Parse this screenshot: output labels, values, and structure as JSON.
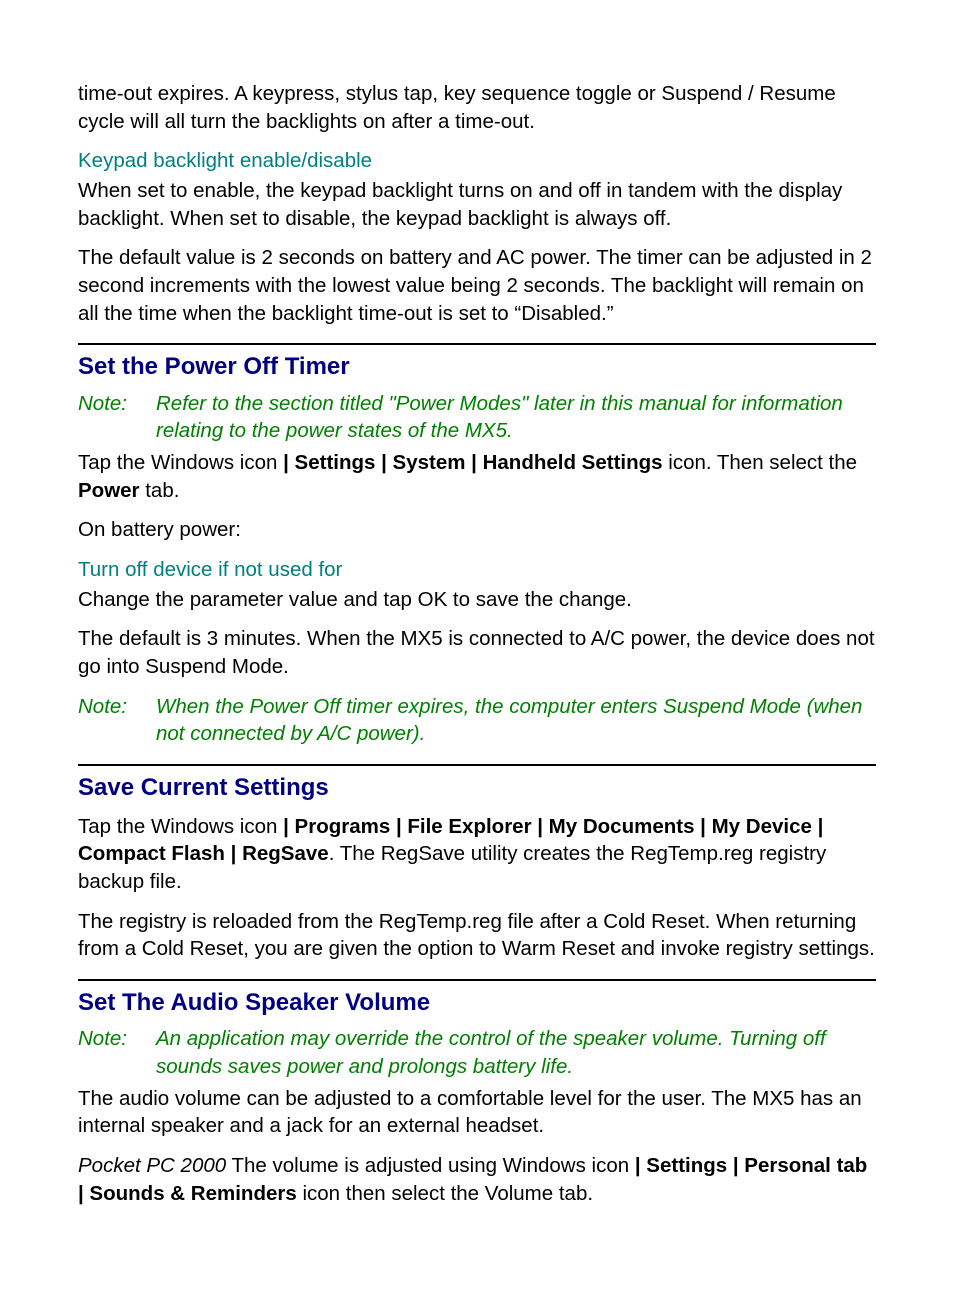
{
  "intro": {
    "p1": "time-out expires. A keypress, stylus tap, key sequence toggle or Suspend / Resume cycle will all turn the backlights on after a time-out.",
    "sub": "Keypad backlight enable/disable",
    "p2": "When set to enable, the keypad backlight turns on and off in tandem with the display backlight. When set to disable, the keypad backlight is always off.",
    "p3": "The default value is 2 seconds on battery and AC power. The timer can be adjusted in 2 second increments with the lowest value being 2 seconds. The backlight will remain on all the time when the backlight time-out is set to “Disabled.”"
  },
  "power": {
    "heading": "Set the Power Off Timer",
    "note1_label": "Note:",
    "note1_body": "Refer to the section titled \"Power Modes\" later in this manual for information relating to the power states of the MX5.",
    "tap1_a": "Tap the Windows icon ",
    "tap1_b": "| Settings | System | Handheld Settings",
    "tap1_c": " icon. Then select the ",
    "tap1_d": "Power",
    "tap1_e": " tab.",
    "onbatt": "On battery power:",
    "sub": "Turn off device if not used for",
    "p_change": "Change the parameter value and tap OK to save the change.",
    "p_default": "The default is 3 minutes. When the MX5 is connected to A/C power, the device does not go into Suspend Mode.",
    "note2_label": "Note:",
    "note2_body": "When the Power Off timer expires, the computer enters Suspend Mode (when not connected by A/C power)."
  },
  "save": {
    "heading": "Save Current Settings",
    "p1_a": "Tap the Windows icon ",
    "p1_b": "| Programs | File Explorer | My Documents | My Device | Compact Flash | RegSave",
    "p1_c": ". The RegSave utility creates the RegTemp.reg registry backup file.",
    "p2": "The registry is reloaded from the RegTemp.reg file after a Cold Reset. When returning from a Cold Reset, you are given the option to Warm Reset and invoke registry settings."
  },
  "audio": {
    "heading": "Set The Audio Speaker Volume",
    "note_label": "Note:",
    "note_body": "An application may override the control of the speaker volume. Turning off sounds saves power and prolongs battery life.",
    "p1": "The audio volume can be adjusted to a comfortable level for the user. The MX5 has an internal speaker and a jack for an external headset.",
    "p2_a": "Pocket PC 2000",
    "p2_b": " The volume is adjusted using Windows icon ",
    "p2_c": "| Settings | Personal tab | Sounds & Reminders",
    "p2_d": " icon then select the Volume tab."
  }
}
